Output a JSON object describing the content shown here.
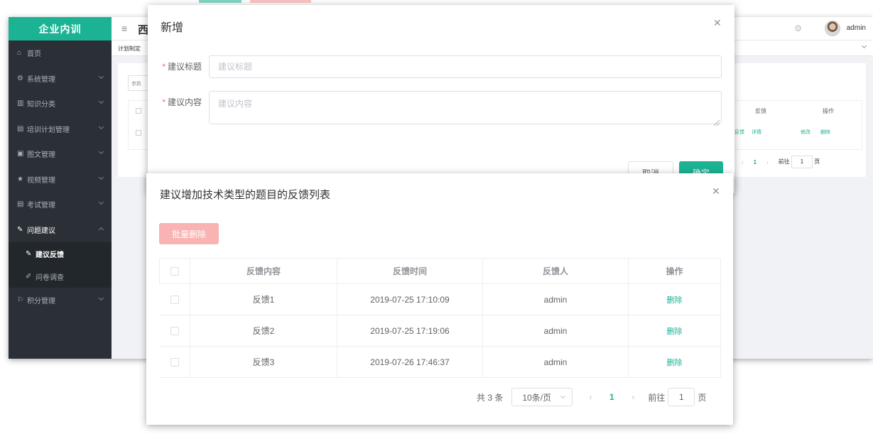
{
  "app": {
    "brand": "企业内训",
    "header_title": "西",
    "user_name": "admin",
    "tab_first": "计划制定"
  },
  "sidebar": {
    "items": [
      {
        "icon": "home-icon",
        "label": "首页"
      },
      {
        "icon": "gear-icon",
        "label": "系统管理"
      },
      {
        "icon": "bar-chart-icon",
        "label": "知识分类"
      },
      {
        "icon": "calendar-icon",
        "label": "培训计划管理"
      },
      {
        "icon": "image-icon",
        "label": "图文管理"
      },
      {
        "icon": "star-icon",
        "label": "视频管理"
      },
      {
        "icon": "exam-icon",
        "label": "考试管理"
      },
      {
        "icon": "edit-icon",
        "label": "问题建议"
      },
      {
        "icon": "flag-icon",
        "label": "积分管理"
      }
    ],
    "sub_items": [
      {
        "icon": "edit-icon",
        "label": "建议反馈"
      },
      {
        "icon": "survey-icon",
        "label": "问卷调查"
      }
    ]
  },
  "background_page": {
    "search_placeholder": "参数",
    "col_feedback": "反馈",
    "col_action": "操作",
    "link_feedback": "反馈",
    "link_detail": "详情",
    "link_edit": "修改",
    "link_delete": "删除",
    "pager_page": "1",
    "pager_goto": "前往",
    "pager_goto_value": "1",
    "pager_unit": "页"
  },
  "dialog_add": {
    "title": "新增",
    "field_title_label": "建议标题",
    "field_title_placeholder": "建议标题",
    "field_content_label": "建议内容",
    "field_content_placeholder": "建议内容",
    "cancel": "取消",
    "confirm": "确定"
  },
  "dialog_list": {
    "title": "建议增加技术类型的题目的反馈列表",
    "batch_delete": "批量删除",
    "columns": [
      "反馈内容",
      "反馈时间",
      "反馈人",
      "操作"
    ],
    "rows": [
      {
        "content": "反馈1",
        "time": "2019-07-25 17:10:09",
        "user": "admin",
        "action": "删除"
      },
      {
        "content": "反馈2",
        "time": "2019-07-25 17:19:06",
        "user": "admin",
        "action": "删除"
      },
      {
        "content": "反馈3",
        "time": "2019-07-26 17:46:37",
        "user": "admin",
        "action": "删除"
      }
    ],
    "pagination": {
      "total": "共 3 条",
      "page_size": "10条/页",
      "current": "1",
      "goto_label": "前往",
      "goto_value": "1",
      "unit": "页"
    }
  },
  "colors": {
    "accent": "#1bb394",
    "sidebar_bg": "#2b3036",
    "danger_light": "#f9b3b3",
    "required": "#f56c6c"
  }
}
